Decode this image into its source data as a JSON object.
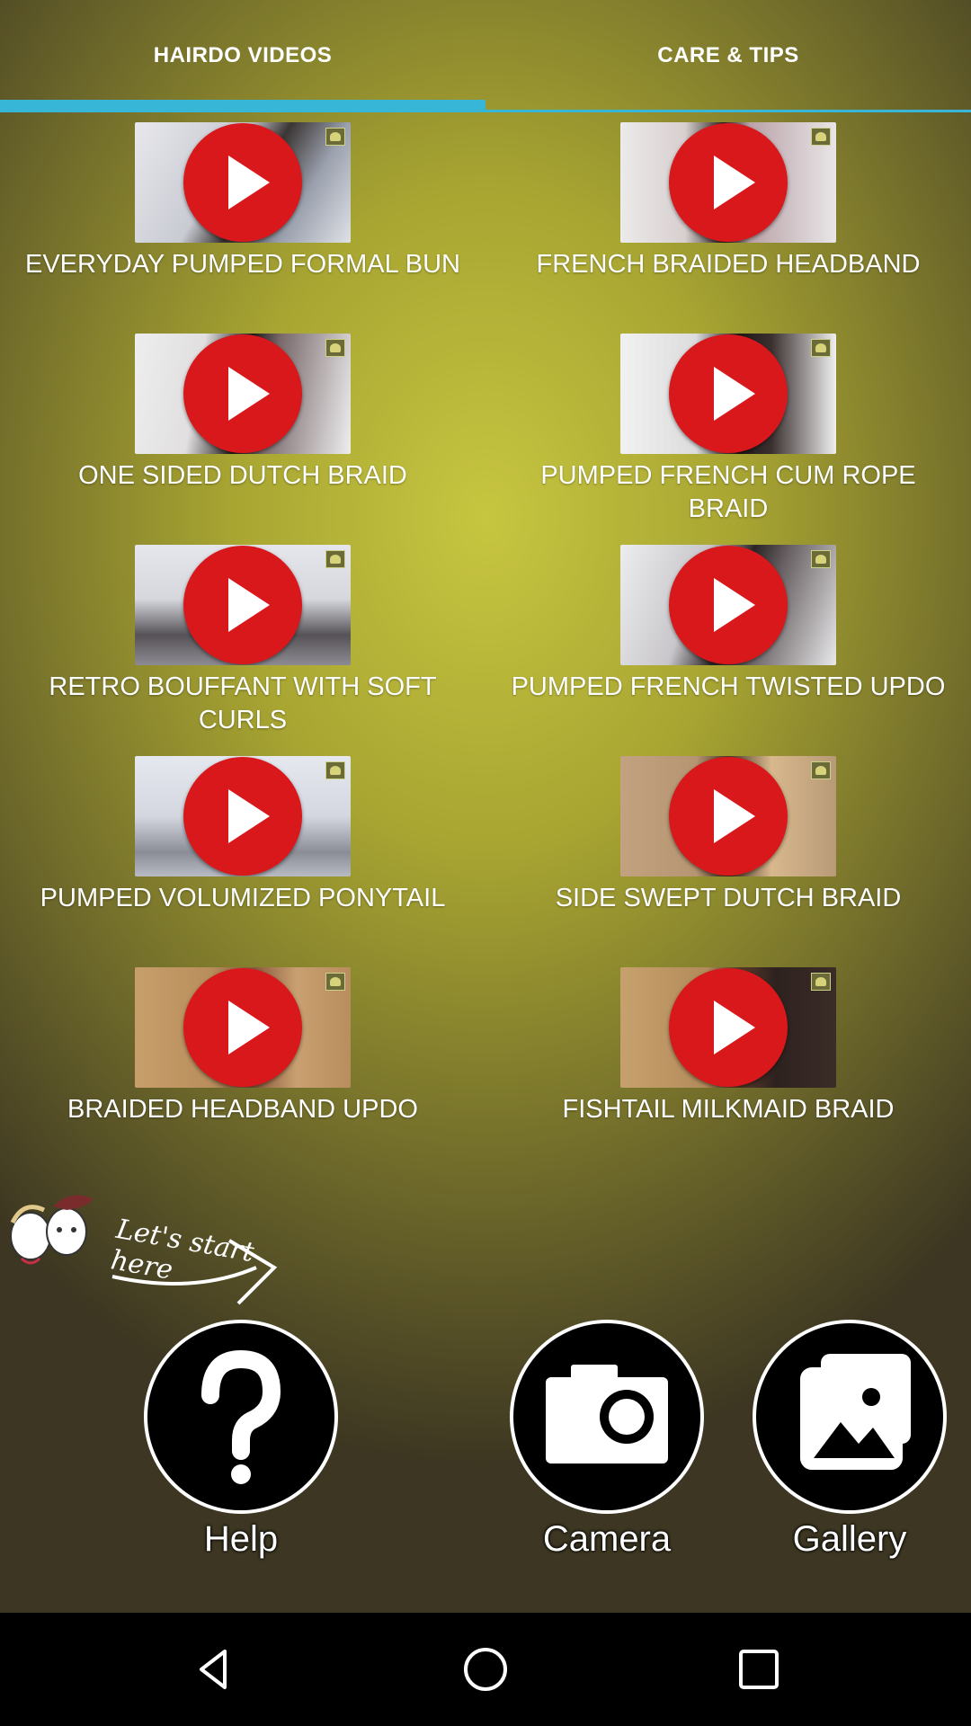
{
  "tabs": [
    {
      "label": "HAIRDO VIDEOS",
      "selected": true
    },
    {
      "label": "CARE & TIPS",
      "selected": false
    }
  ],
  "accent_color": "#38b6d8",
  "play_color": "#d9181c",
  "videos": [
    {
      "title": "EVERYDAY PUMPED FORMAL BUN"
    },
    {
      "title": "FRENCH BRAIDED HEADBAND"
    },
    {
      "title": "ONE SIDED DUTCH BRAID"
    },
    {
      "title": "PUMPED FRENCH CUM ROPE BRAID"
    },
    {
      "title": "RETRO BOUFFANT WITH SOFT CURLS"
    },
    {
      "title": "PUMPED FRENCH TWISTED UPDO"
    },
    {
      "title": "PUMPED VOLUMIZED PONYTAIL"
    },
    {
      "title": "SIDE SWEPT DUTCH BRAID"
    },
    {
      "title": "BRAIDED HEADBAND UPDO"
    },
    {
      "title": "FISHTAIL MILKMAID BRAID"
    }
  ],
  "promo": {
    "text_a": "Let's start",
    "text_b": "here"
  },
  "actions": {
    "help": "Help",
    "camera": "Camera",
    "gallery": "Gallery"
  },
  "nav_icons": [
    "back-icon",
    "home-icon",
    "recents-icon"
  ]
}
